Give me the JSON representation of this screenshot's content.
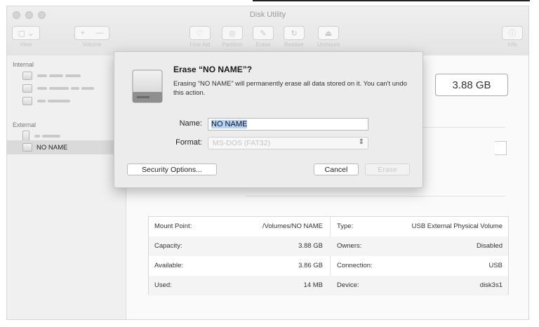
{
  "window": {
    "title": "Disk Utility"
  },
  "toolbar": {
    "view_label": "View",
    "volume_label": "Volume",
    "first_aid_label": "First Aid",
    "partition_label": "Partition",
    "erase_label": "Erase",
    "restore_label": "Restore",
    "unmount_label": "Unmount",
    "info_label": "Info",
    "add_symbol": "+",
    "remove_symbol": "—"
  },
  "sidebar": {
    "internal_header": "Internal",
    "external_header": "External",
    "selected_item": "NO NAME"
  },
  "main": {
    "capacity": "3.88 GB"
  },
  "info_table": {
    "left": [
      {
        "label": "Mount Point:",
        "value": "/Volumes/NO NAME"
      },
      {
        "label": "Capacity:",
        "value": "3.88 GB"
      },
      {
        "label": "Available:",
        "value": "3.86 GB"
      },
      {
        "label": "Used:",
        "value": "14 MB"
      }
    ],
    "right": [
      {
        "label": "Type:",
        "value": "USB External Physical Volume"
      },
      {
        "label": "Owners:",
        "value": "Disabled"
      },
      {
        "label": "Connection:",
        "value": "USB"
      },
      {
        "label": "Device:",
        "value": "disk3s1"
      }
    ]
  },
  "dialog": {
    "title": "Erase “NO NAME”?",
    "message": "Erasing “NO NAME” will permanently erase all data stored on it. You can't undo this action.",
    "name_label": "Name:",
    "name_value": "NO NAME",
    "format_label": "Format:",
    "format_value": "MS-DOS (FAT32)",
    "security_button": "Security Options...",
    "cancel_button": "Cancel",
    "erase_button": "Erase"
  }
}
